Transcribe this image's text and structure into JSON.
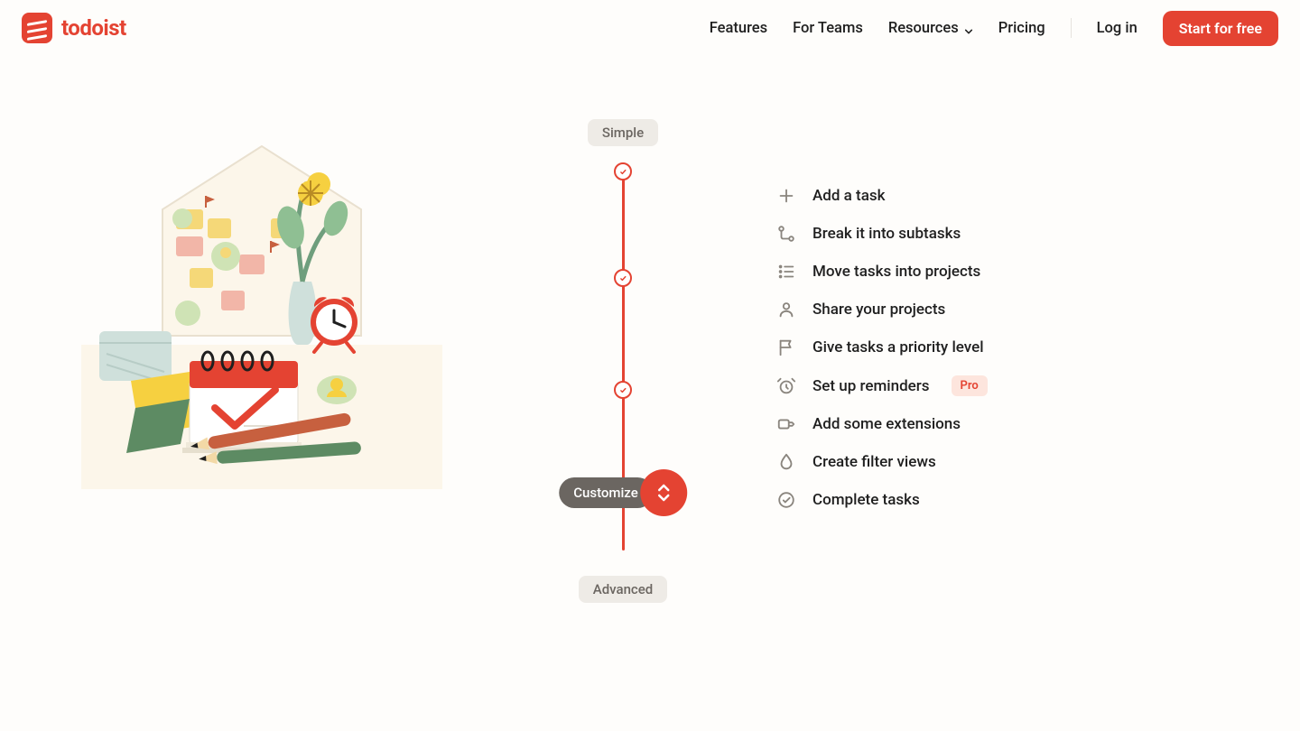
{
  "brand": {
    "name": "todoist"
  },
  "nav": {
    "features": "Features",
    "for_teams": "For Teams",
    "resources": "Resources",
    "pricing": "Pricing",
    "login": "Log in",
    "cta": "Start for free"
  },
  "slider": {
    "top_label": "Simple",
    "bottom_label": "Advanced",
    "handle_label": "Customize"
  },
  "features": [
    {
      "icon": "plus",
      "label": "Add a task"
    },
    {
      "icon": "subtask",
      "label": "Break it into subtasks"
    },
    {
      "icon": "list",
      "label": "Move tasks into projects"
    },
    {
      "icon": "person",
      "label": "Share your projects"
    },
    {
      "icon": "flag",
      "label": "Give tasks a priority level"
    },
    {
      "icon": "alarm",
      "label": "Set up reminders",
      "badge": "Pro"
    },
    {
      "icon": "puzzle",
      "label": "Add some extensions"
    },
    {
      "icon": "droplet",
      "label": "Create filter views"
    },
    {
      "icon": "check",
      "label": "Complete tasks"
    }
  ],
  "colors": {
    "accent": "#e44332",
    "muted_bg": "#eeebe6",
    "muted_fg": "#6b6661",
    "icon": "#8a857e",
    "pro_bg": "#fde5dd"
  }
}
